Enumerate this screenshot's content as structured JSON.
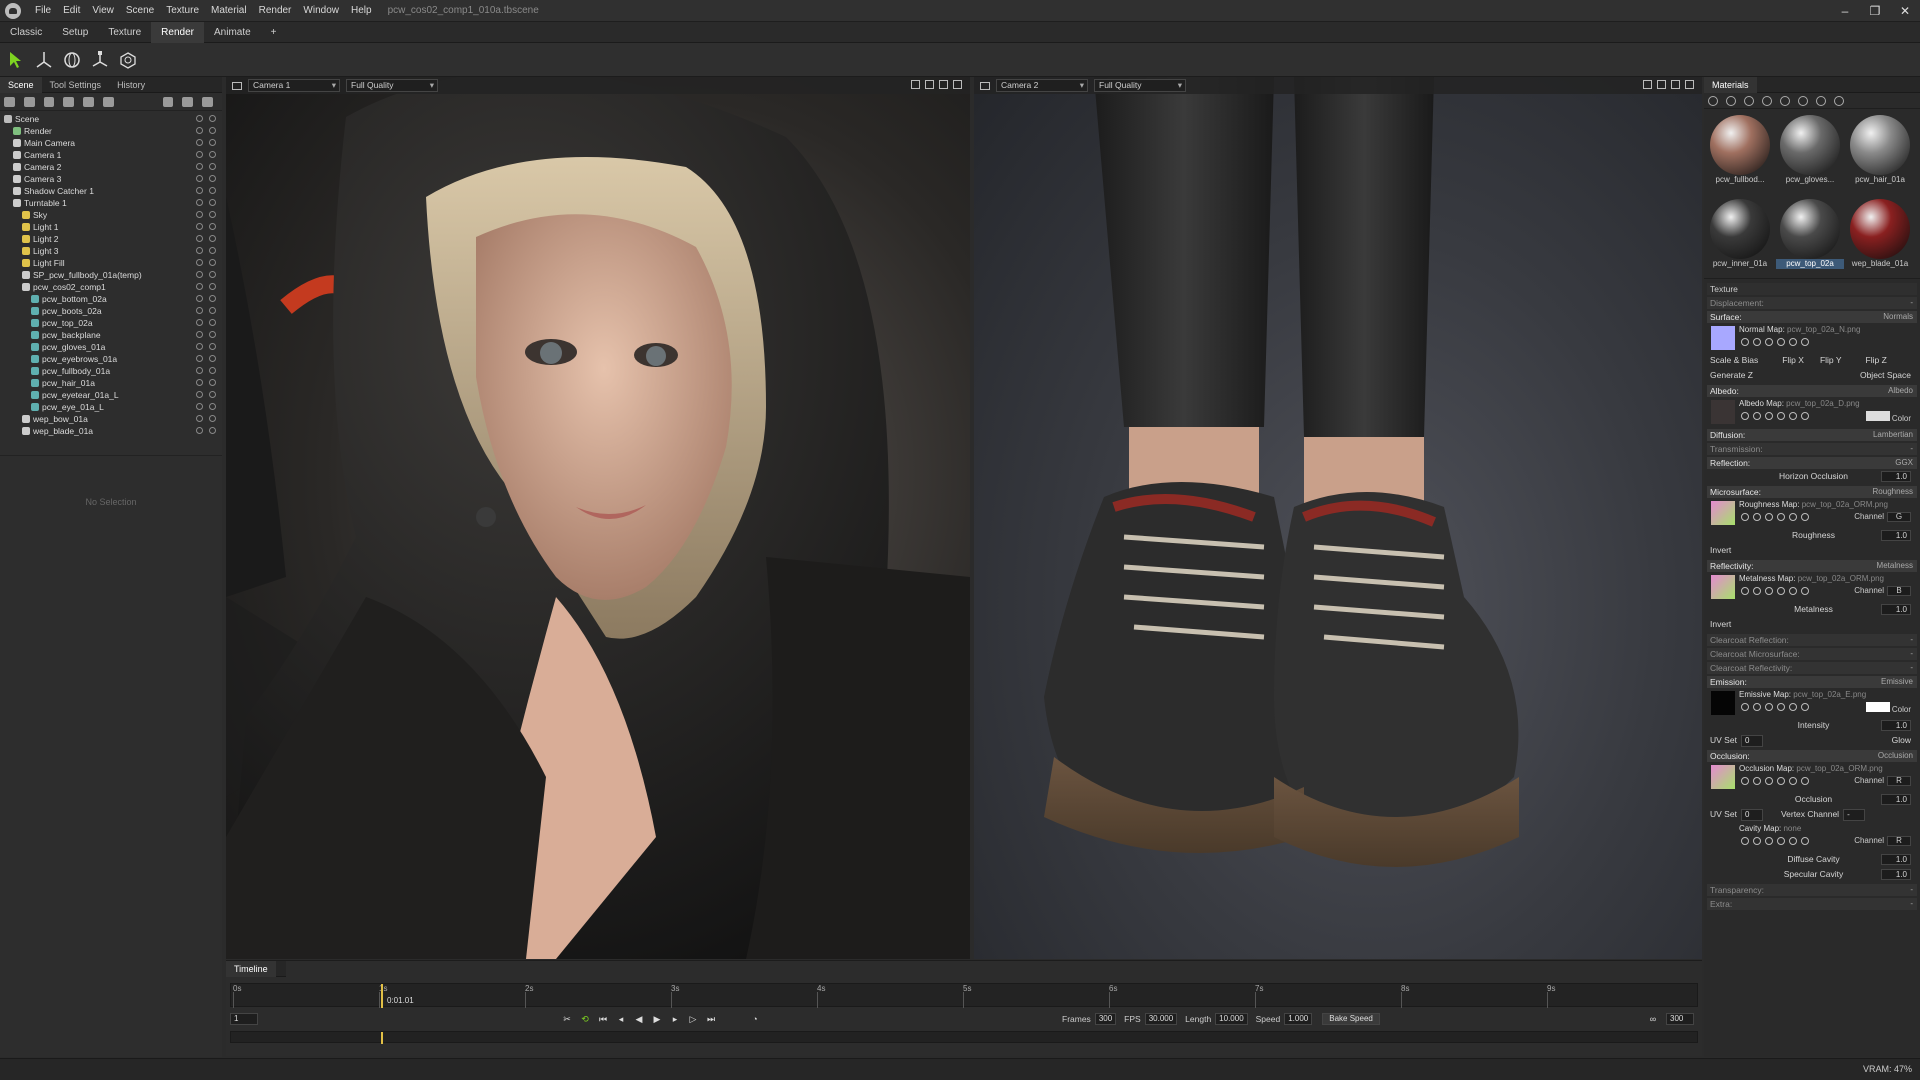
{
  "menubar": {
    "items": [
      "File",
      "Edit",
      "View",
      "Scene",
      "Texture",
      "Material",
      "Render",
      "Window",
      "Help"
    ],
    "document_title": "pcw_cos02_comp1_010a.tbscene"
  },
  "workspace_tabs": [
    "Classic",
    "Setup",
    "Texture",
    "Render",
    "Animate",
    "+"
  ],
  "active_workspace": "Render",
  "scene_panel": {
    "tabs": [
      "Scene",
      "Tool Settings",
      "History"
    ],
    "tree": [
      {
        "label": "Scene",
        "depth": 0,
        "color": "#bbbbbb"
      },
      {
        "label": "Render",
        "depth": 1,
        "color": "#7fbf7f"
      },
      {
        "label": "Main Camera",
        "depth": 1,
        "color": "#cccccc"
      },
      {
        "label": "Camera 1",
        "depth": 1,
        "color": "#cccccc"
      },
      {
        "label": "Camera 2",
        "depth": 1,
        "color": "#cccccc"
      },
      {
        "label": "Camera 3",
        "depth": 1,
        "color": "#cccccc"
      },
      {
        "label": "Shadow Catcher 1",
        "depth": 1,
        "color": "#cccccc"
      },
      {
        "label": "Turntable 1",
        "depth": 1,
        "color": "#cccccc"
      },
      {
        "label": "Sky",
        "depth": 2,
        "color": "#e0c34a"
      },
      {
        "label": "Light 1",
        "depth": 2,
        "color": "#e0c34a"
      },
      {
        "label": "Light 2",
        "depth": 2,
        "color": "#e0c34a"
      },
      {
        "label": "Light 3",
        "depth": 2,
        "color": "#e0c34a"
      },
      {
        "label": "Light Fill",
        "depth": 2,
        "color": "#e0c34a"
      },
      {
        "label": "SP_pcw_fullbody_01a(temp)",
        "depth": 2,
        "color": "#cccccc"
      },
      {
        "label": "pcw_cos02_comp1",
        "depth": 2,
        "color": "#cccccc"
      },
      {
        "label": "pcw_bottom_02a",
        "depth": 3,
        "color": "#5fb0b0"
      },
      {
        "label": "pcw_boots_02a",
        "depth": 3,
        "color": "#5fb0b0"
      },
      {
        "label": "pcw_top_02a",
        "depth": 3,
        "color": "#5fb0b0"
      },
      {
        "label": "pcw_backplane",
        "depth": 3,
        "color": "#5fb0b0"
      },
      {
        "label": "pcw_gloves_01a",
        "depth": 3,
        "color": "#5fb0b0"
      },
      {
        "label": "pcw_eyebrows_01a",
        "depth": 3,
        "color": "#5fb0b0"
      },
      {
        "label": "pcw_fullbody_01a",
        "depth": 3,
        "color": "#5fb0b0"
      },
      {
        "label": "pcw_hair_01a",
        "depth": 3,
        "color": "#5fb0b0"
      },
      {
        "label": "pcw_eyetear_01a_L",
        "depth": 3,
        "color": "#5fb0b0"
      },
      {
        "label": "pcw_eye_01a_L",
        "depth": 3,
        "color": "#5fb0b0"
      },
      {
        "label": "wep_bow_01a",
        "depth": 2,
        "color": "#cccccc"
      },
      {
        "label": "wep_blade_01a",
        "depth": 2,
        "color": "#cccccc"
      }
    ],
    "no_selection": "No Selection"
  },
  "viewport1": {
    "camera": "Camera 1",
    "quality": "Full Quality"
  },
  "viewport2": {
    "camera": "Camera 2",
    "quality": "Full Quality"
  },
  "timeline": {
    "title": "Timeline",
    "ticks": [
      "0s",
      "1s",
      "2s",
      "3s",
      "4s",
      "5s",
      "6s",
      "7s",
      "8s",
      "9s"
    ],
    "current_time": "0:01.01",
    "start_frame": "1",
    "frames_label": "Frames",
    "frames": "300",
    "fps_label": "FPS",
    "fps": "30.000",
    "length_label": "Length",
    "length": "10.000",
    "speed_label": "Speed",
    "speed": "1.000",
    "bake_speed": "Bake Speed",
    "end_frame": "300"
  },
  "materials_panel": {
    "title": "Materials",
    "materials": [
      {
        "name": "pcw_fullbod...",
        "color": "#a07060"
      },
      {
        "name": "pcw_gloves...",
        "color": "#6a6a6a"
      },
      {
        "name": "pcw_hair_01a",
        "color": "#8a8a8a"
      },
      {
        "name": "pcw_inner_01a",
        "color": "#3a3a3a"
      },
      {
        "name": "pcw_top_02a",
        "color": "#4a4a4a"
      },
      {
        "name": "wep_blade_01a",
        "color": "#8a2020"
      }
    ],
    "selected_material": "pcw_top_02a",
    "texture_label": "Texture",
    "displacement_label": "Displacement:",
    "surface": {
      "label": "Surface:",
      "mode": "Normals"
    },
    "normal_map": {
      "label": "Normal Map:",
      "file": "pcw_top_02a_N.png"
    },
    "scale_bias": "Scale & Bias",
    "flip_x": "Flip X",
    "flip_y": "Flip Y",
    "flip_z": "Flip Z",
    "generate_z": "Generate Z",
    "object_space": "Object Space",
    "albedo": {
      "label": "Albedo:",
      "mode": "Albedo"
    },
    "albedo_map": {
      "label": "Albedo Map:",
      "file": "pcw_top_02a_D.png"
    },
    "color_label": "Color",
    "diffusion": {
      "label": "Diffusion:",
      "mode": "Lambertian"
    },
    "transmission_label": "Transmission:",
    "reflection": {
      "label": "Reflection:",
      "mode": "GGX"
    },
    "horizon_occlusion": {
      "label": "Horizon Occlusion",
      "value": "1.0"
    },
    "microsurface": {
      "label": "Microsurface:",
      "mode": "Roughness"
    },
    "roughness_map": {
      "label": "Roughness Map:",
      "file": "pcw_top_02a_ORM.png",
      "channel": "G"
    },
    "channel_label": "Channel",
    "roughness": {
      "label": "Roughness",
      "value": "1.0"
    },
    "invert_label": "Invert",
    "reflectivity": {
      "label": "Reflectivity:",
      "mode": "Metalness"
    },
    "metalness_map": {
      "label": "Metalness Map:",
      "file": "pcw_top_02a_ORM.png",
      "channel": "B"
    },
    "metalness": {
      "label": "Metalness",
      "value": "1.0"
    },
    "clearcoat_reflection": "Clearcoat Reflection:",
    "clearcoat_microsurface": "Clearcoat Microsurface:",
    "clearcoat_reflectivity": "Clearcoat Reflectivity:",
    "emission": {
      "label": "Emission:",
      "mode": "Emissive"
    },
    "emissive_map": {
      "label": "Emissive Map:",
      "file": "pcw_top_02a_E.png"
    },
    "intensity": {
      "label": "Intensity",
      "value": "1.0"
    },
    "uv_set": {
      "label": "UV Set",
      "value": "0"
    },
    "glow_label": "Glow",
    "occlusion": {
      "label": "Occlusion:",
      "mode": "Occlusion"
    },
    "occlusion_map": {
      "label": "Occlusion Map:",
      "file": "pcw_top_02a_ORM.png",
      "channel": "R"
    },
    "occlusion_value": {
      "label": "Occlusion",
      "value": "1.0"
    },
    "vertex_channel": {
      "label": "Vertex Channel",
      "value": "-"
    },
    "cavity_map": {
      "label": "Cavity Map:",
      "file": "none",
      "channel": "R"
    },
    "diffuse_cavity": {
      "label": "Diffuse Cavity",
      "value": "1.0"
    },
    "specular_cavity": {
      "label": "Specular Cavity",
      "value": "1.0"
    },
    "transparency_label": "Transparency:",
    "extra_label": "Extra:"
  },
  "status": {
    "vram": "VRAM: 47%"
  }
}
